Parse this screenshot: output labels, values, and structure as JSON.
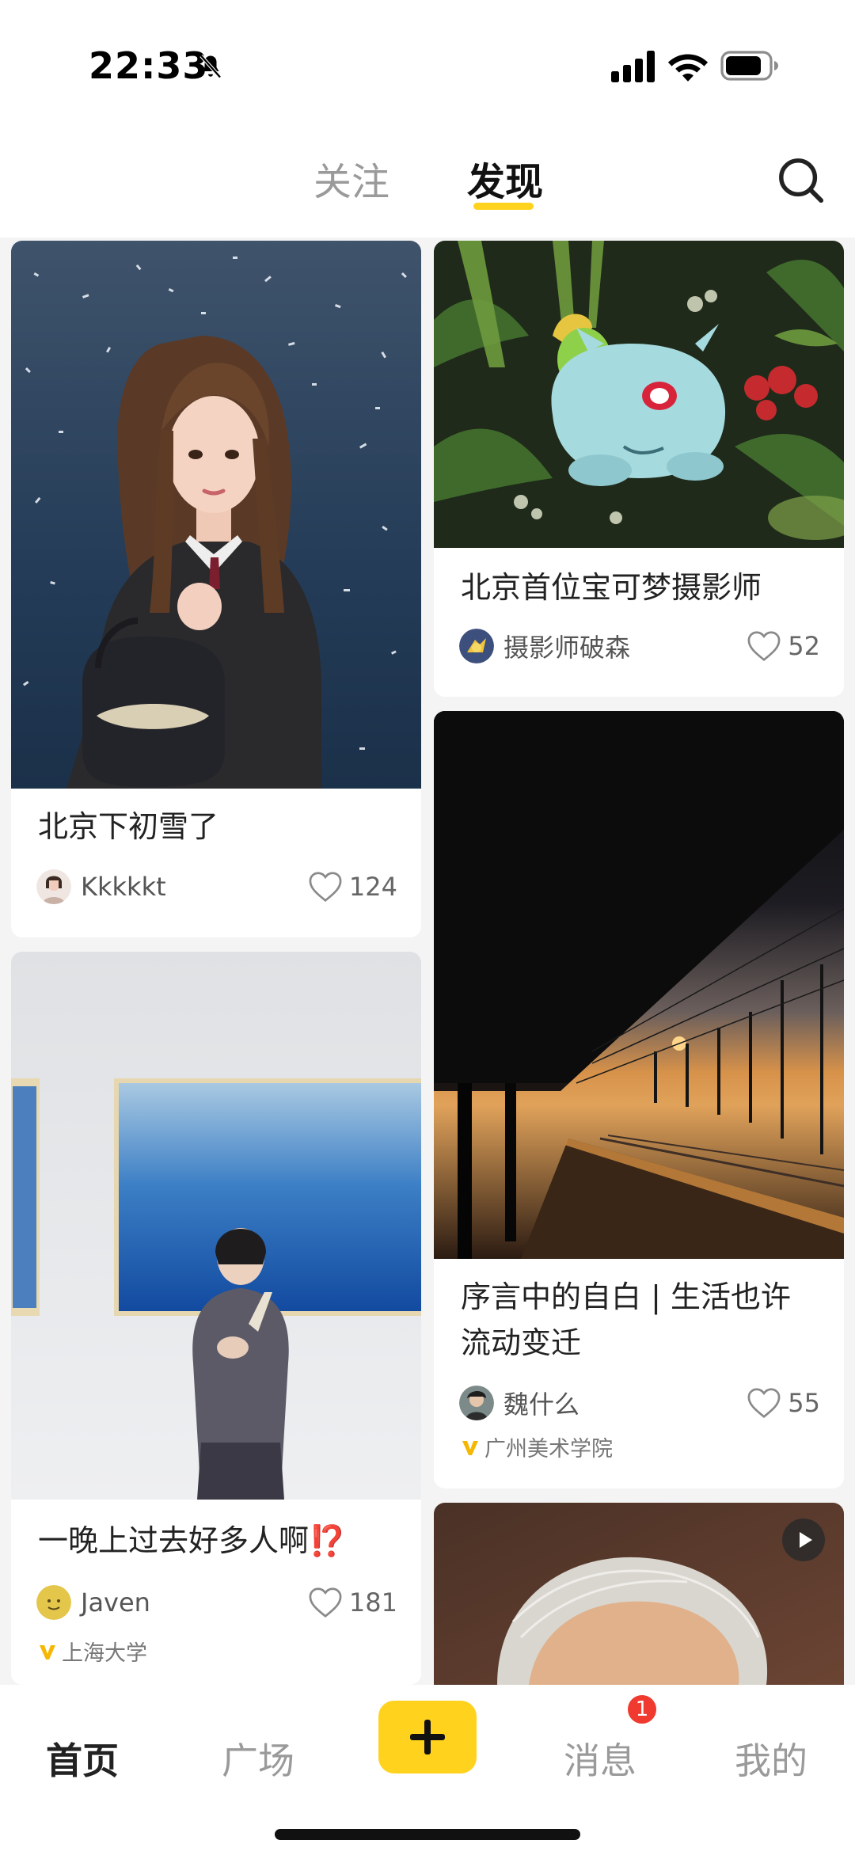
{
  "status_bar": {
    "time": "22:33"
  },
  "header": {
    "tab_follow": "关注",
    "tab_discover": "发现"
  },
  "feed": {
    "card1": {
      "title": "北京下初雪了",
      "user": "Kkkkkt",
      "likes": "124"
    },
    "card2": {
      "title": "北京首位宝可梦摄影师",
      "user": "摄影师破森",
      "likes": "52"
    },
    "card3": {
      "title": "一晚上过去好多人啊⁉️",
      "user": "Javen",
      "likes": "181",
      "school": "上海大学"
    },
    "card4": {
      "title_line1": "序言中的自白 | 生活也许",
      "title_line2": "流动变迁",
      "user": "魏什么",
      "likes": "55",
      "school": "广州美术学院"
    }
  },
  "bottom_nav": {
    "home": "首页",
    "plaza": "广场",
    "messages": "消息",
    "me": "我的",
    "message_badge": "1"
  },
  "colors": {
    "accent": "#ffd21e",
    "badge": "#f0392f"
  }
}
